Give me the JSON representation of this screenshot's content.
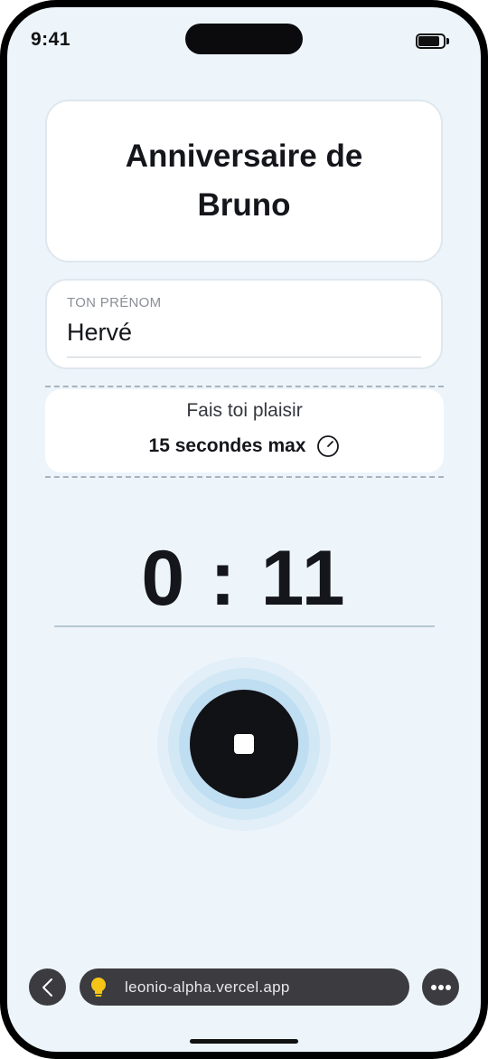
{
  "status_bar": {
    "time": "9:41"
  },
  "event": {
    "title": "Anniversaire de Bruno"
  },
  "name_field": {
    "label": "TON PRÉNOM",
    "value": "Hervé"
  },
  "prompt": {
    "text": "Fais toi plaisir",
    "limit": "15 secondes max",
    "icon": "timer-icon"
  },
  "recorder": {
    "countdown": "0 : 11",
    "button_icon": "stop-icon",
    "state": "recording"
  },
  "browser": {
    "url": "leonio-alpha.vercel.app",
    "back_icon": "chevron-left-icon",
    "site_icon": "lightbulb-icon",
    "more_icon": "ellipsis-icon"
  },
  "colors": {
    "background": "#edf5fb",
    "accent_ring": "#bfdef2",
    "button": "#111216",
    "bulb": "#f5c518"
  }
}
